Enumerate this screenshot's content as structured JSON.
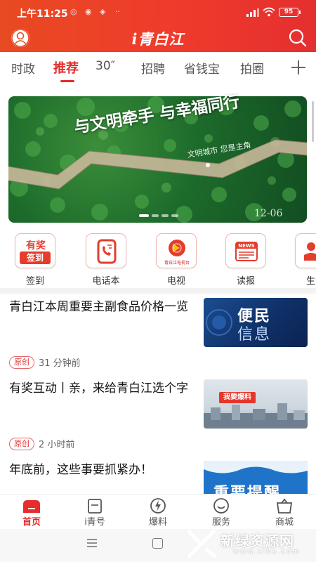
{
  "status_bar": {
    "time": "上午11:25",
    "battery": "95"
  },
  "header": {
    "logo_text": "i青白江",
    "accent_color": "#e62c2c",
    "icons": [
      "avatar-icon",
      "search-icon"
    ]
  },
  "tabs": [
    {
      "label": "时政",
      "active": false
    },
    {
      "label": "推荐",
      "active": true
    },
    {
      "label": "30″",
      "active": false
    },
    {
      "label": "招聘",
      "active": false
    },
    {
      "label": "省钱宝",
      "active": false
    },
    {
      "label": "拍圈",
      "active": false
    }
  ],
  "banner": {
    "title": "与文明牵手  与幸福同行",
    "subtitle": "文明城市  您是主角",
    "date": "12-06",
    "slide_count": 4,
    "active_slide": 1
  },
  "quick_links": [
    {
      "label": "签到",
      "icon": "checkin-icon",
      "badge_line1": "有奖",
      "badge_line2": "签到"
    },
    {
      "label": "电话本",
      "icon": "phonebook-icon"
    },
    {
      "label": "电视",
      "icon": "tv-icon",
      "badge_text": "青白江电视台"
    },
    {
      "label": "读报",
      "icon": "newspaper-icon",
      "badge_text": "NEWS"
    },
    {
      "label": "生活",
      "icon": "life-icon"
    }
  ],
  "news": [
    {
      "title": "青白江本周重要主副食品价格一览",
      "tag": "原创",
      "time": "31 分钟前",
      "thumb_line1": "便民",
      "thumb_line2": "信息"
    },
    {
      "title": "有奖互动丨亲，来给青白江选个字",
      "tag": "原创",
      "time": "2 小时前",
      "thumb_text": "我要爆料"
    },
    {
      "title": "年底前，这些事要抓紧办！",
      "thumb_text": "重要提醒"
    }
  ],
  "bottom_nav": [
    {
      "label": "首页",
      "icon": "home-icon",
      "active": true
    },
    {
      "label": "i青号",
      "icon": "bookmark-icon",
      "active": false
    },
    {
      "label": "爆料",
      "icon": "lightning-icon",
      "active": false
    },
    {
      "label": "服务",
      "icon": "smile-icon",
      "active": false
    },
    {
      "label": "商城",
      "icon": "shop-icon",
      "active": false
    }
  ],
  "watermark": {
    "title": "新绿资源网",
    "url": "www.xlhs.com"
  }
}
